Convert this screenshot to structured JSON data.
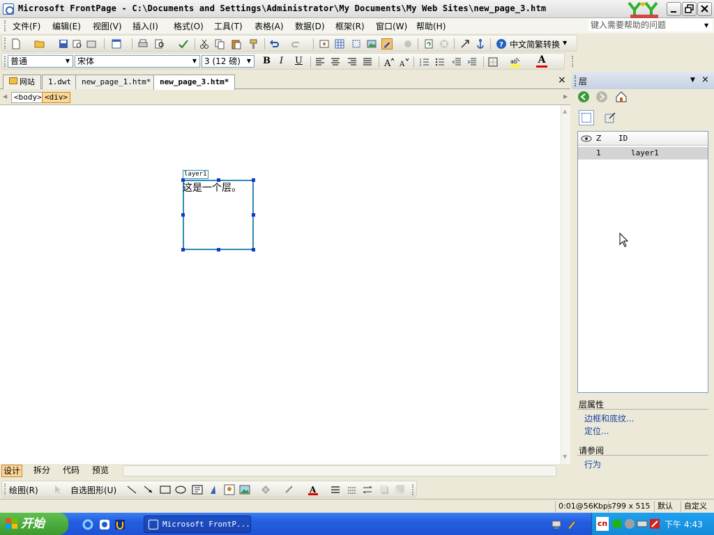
{
  "window": {
    "title": "Microsoft FrontPage - C:\\Documents and Settings\\Administrator\\My Documents\\My Web Sites\\new_page_3.htm"
  },
  "menu": {
    "items": [
      "文件(F)",
      "编辑(E)",
      "视图(V)",
      "插入(I)",
      "格式(O)",
      "工具(T)",
      "表格(A)",
      "数据(D)",
      "框架(R)",
      "窗口(W)",
      "帮助(H)"
    ],
    "help_placeholder": "键入需要帮助的问题"
  },
  "standard_toolbar": {
    "convert_label": "中文简繁转换"
  },
  "format_toolbar": {
    "style": "普通",
    "font": "宋体",
    "size": "3 (12 磅)",
    "bold": "B",
    "italic": "I",
    "underline": "U",
    "font_color_glyph": "A"
  },
  "document_tabs": {
    "site": "网站",
    "tabs": [
      "1.dwt",
      "new_page_1.htm*",
      "new_page_3.htm*"
    ],
    "active_index": 2,
    "close": "×"
  },
  "tag_selector": [
    "<body>",
    "<div>"
  ],
  "editor": {
    "layer_tag": "layer1",
    "layer_text": "这是一个层。"
  },
  "view_tabs": [
    "设计",
    "拆分",
    "代码",
    "预览"
  ],
  "drawing_toolbar": {
    "draw": "绘图(R)",
    "autoshapes": "自选图形(U)"
  },
  "status": {
    "speed": "0:01@56Kbps",
    "dimensions": "799 x 515",
    "default": "默认",
    "custom": "自定义"
  },
  "task_pane": {
    "title": "层",
    "columns": {
      "z": "Z",
      "id": "ID"
    },
    "rows": [
      {
        "z": "1",
        "id": "layer1"
      }
    ],
    "properties_heading": "层属性",
    "links": [
      "边框和底纹...",
      "定位..."
    ],
    "see_also_heading": "请参阅",
    "see_also_links": [
      "行为"
    ]
  },
  "taskbar": {
    "start": "开始",
    "window_button": "Microsoft FrontP...",
    "ime": "cn",
    "clock": "下午 4:43"
  }
}
